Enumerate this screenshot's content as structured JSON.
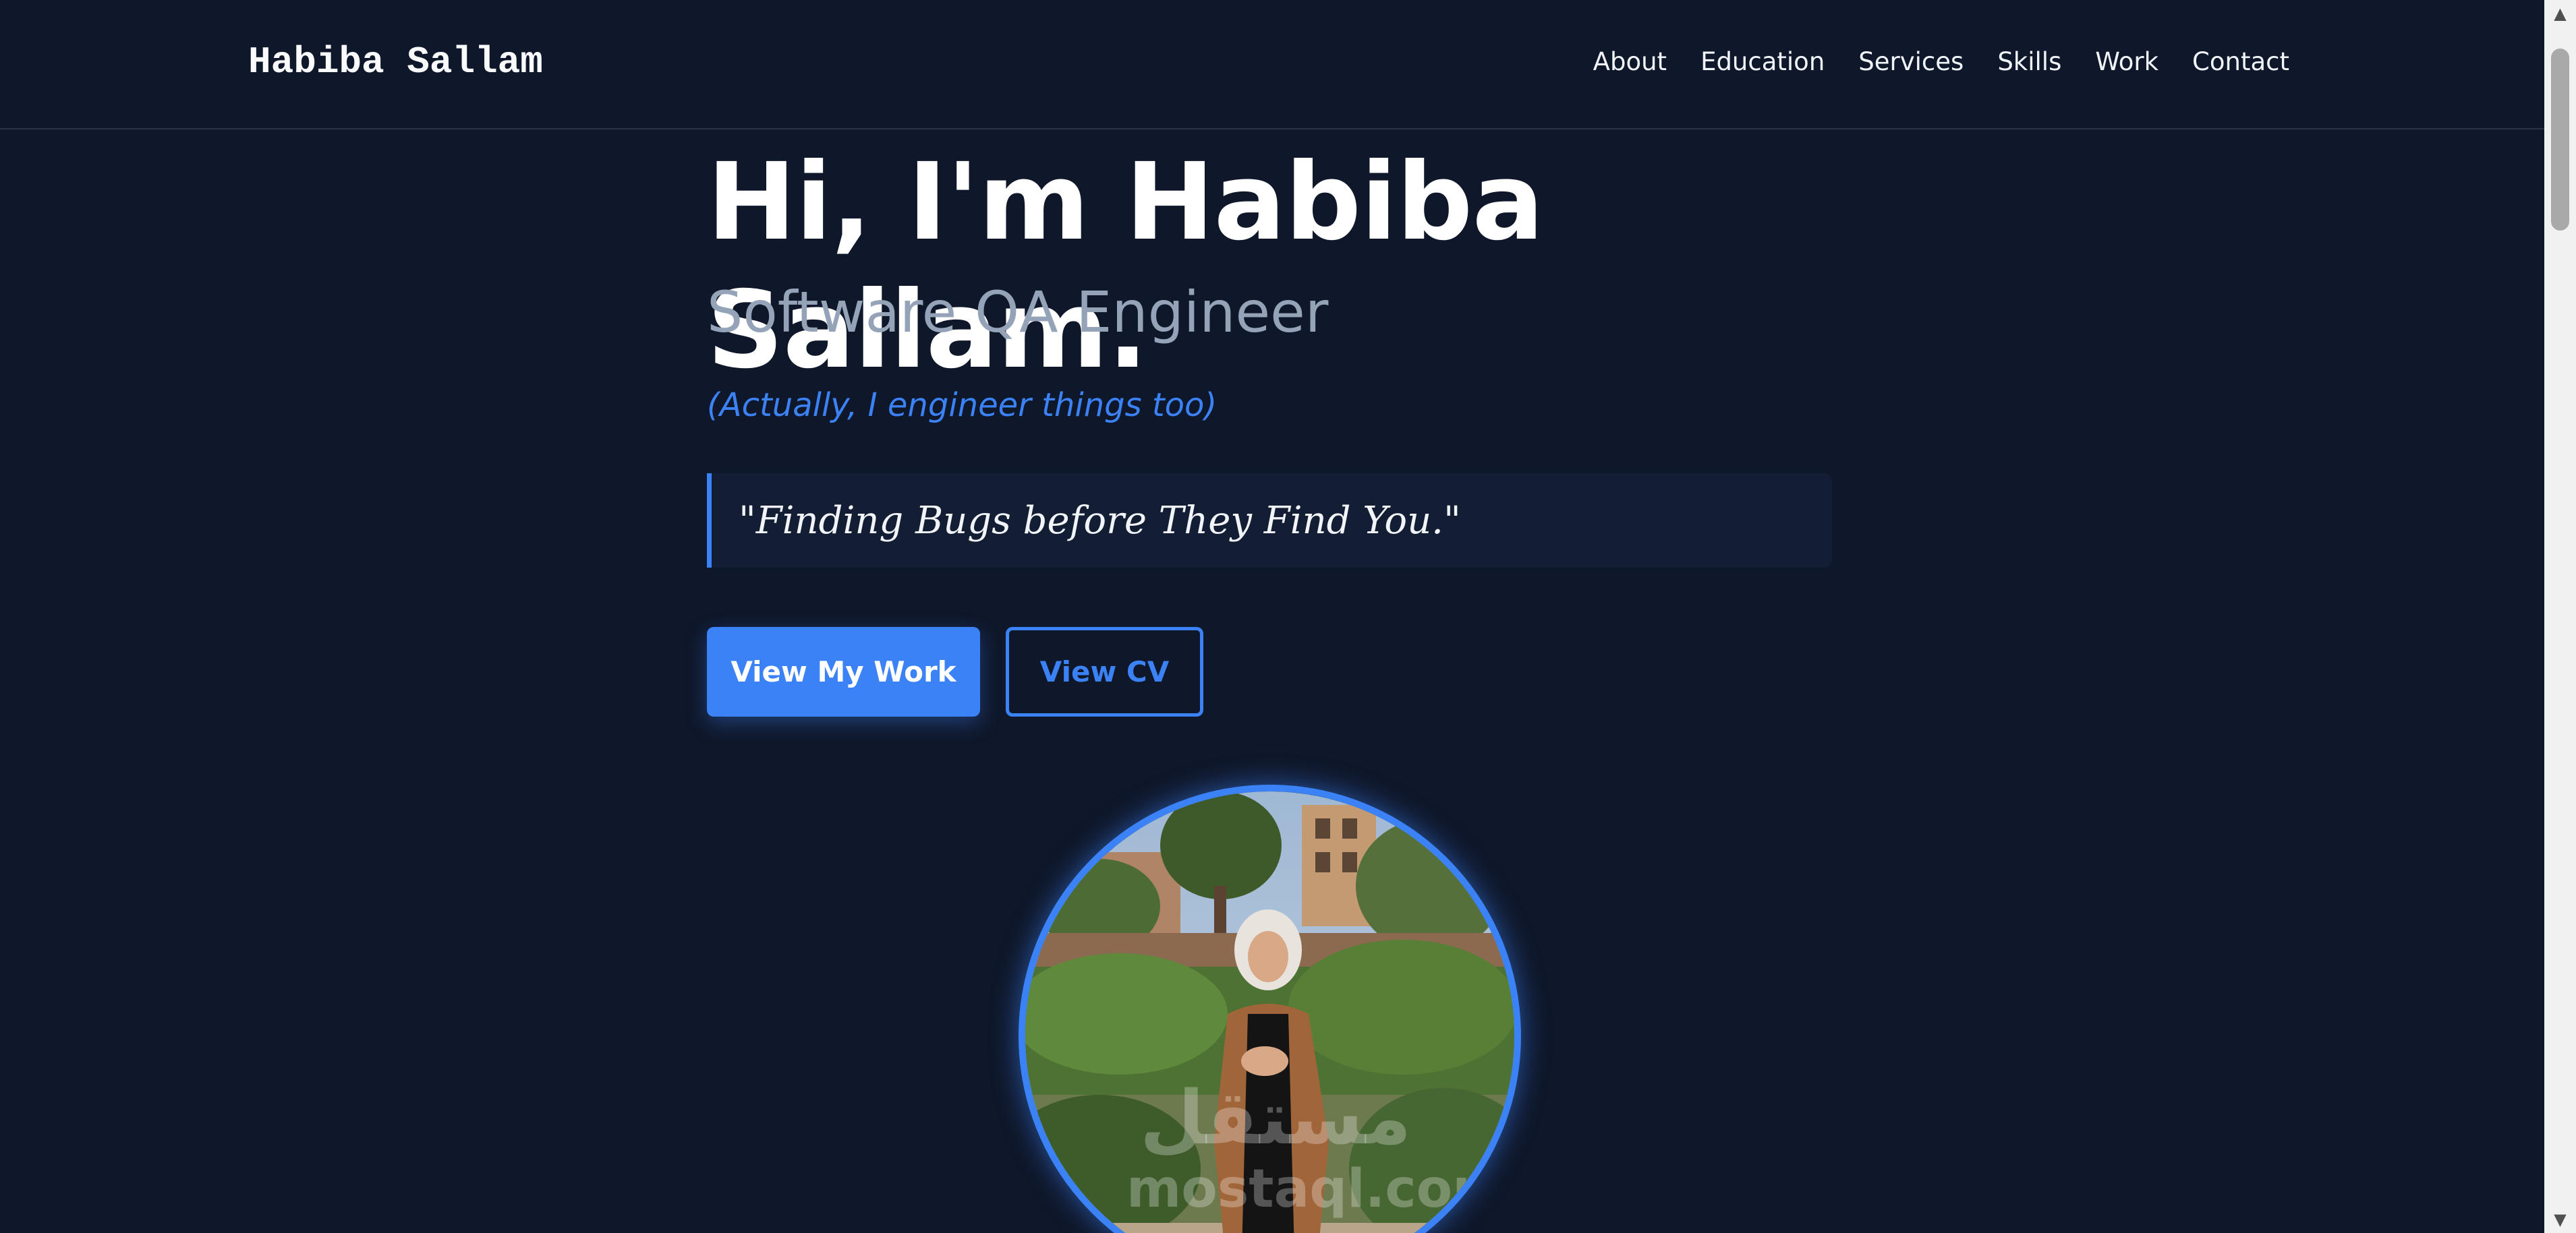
{
  "header": {
    "logo": "Habiba Sallam",
    "nav": [
      "About",
      "Education",
      "Services",
      "Skills",
      "Work",
      "Contact"
    ]
  },
  "hero": {
    "title": "Hi, I'm Habiba Sallam.",
    "role": "Software QA Engineer",
    "aside": "(Actually, I engineer things too)",
    "quote": "\"Finding Bugs before They Find You.\"",
    "primary_button": "View My Work",
    "secondary_button": "View CV"
  },
  "avatar": {
    "watermark_ar": "مستقل",
    "watermark_en": "mostaql.com"
  },
  "colors": {
    "background": "#0f172a",
    "accent": "#3b82f6",
    "muted": "#94a3b8"
  }
}
